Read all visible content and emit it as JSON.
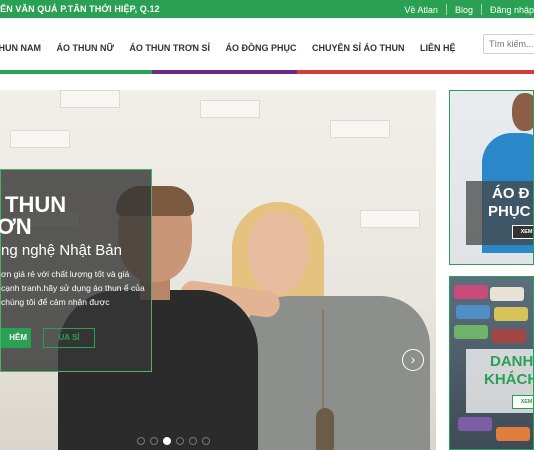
{
  "topbar": {
    "address": "YẾN VĂN QUÁ P.TÂN THỚI HIỆP, Q.12",
    "links": [
      "Về Atlan",
      "Blog",
      "Đăng nhập"
    ]
  },
  "nav": {
    "items": [
      "THUN NAM",
      "ÁO THUN NỮ",
      "ÁO THUN TRƠN SỈ",
      "ÁO ĐỒNG PHỤC",
      "CHUYÊN SỈ ÁO THUN",
      "LIÊN HỆ"
    ],
    "search_placeholder": "Tìm kiếm..."
  },
  "slider": {
    "title_line1": "THUN",
    "title_line2": "ƠN",
    "subtitle": "ng nghệ Nhật Bản",
    "body": "ơn giá rẻ với chất lượng tốt và giá cạnh tranh.hãy sử dụng áo thun ể của chúng tôi để cảm nhận được",
    "primary_button": "HÊM",
    "secondary_button": "UA SỈ",
    "next_icon": "chevron-right-circle-icon",
    "dots_count": 6,
    "active_dot": 3
  },
  "cards": [
    {
      "title_line1": "ÁO Đ",
      "title_line2": "PHỤC",
      "button": "XEM T"
    },
    {
      "title_line1": "DANH",
      "title_line2": "KHÁCH H",
      "button": "XEM T"
    }
  ],
  "colors": {
    "brand_green": "#2aa052",
    "bar_green": "#27a35a",
    "bar_purple": "#6b2b86",
    "bar_red": "#d63b3b"
  }
}
